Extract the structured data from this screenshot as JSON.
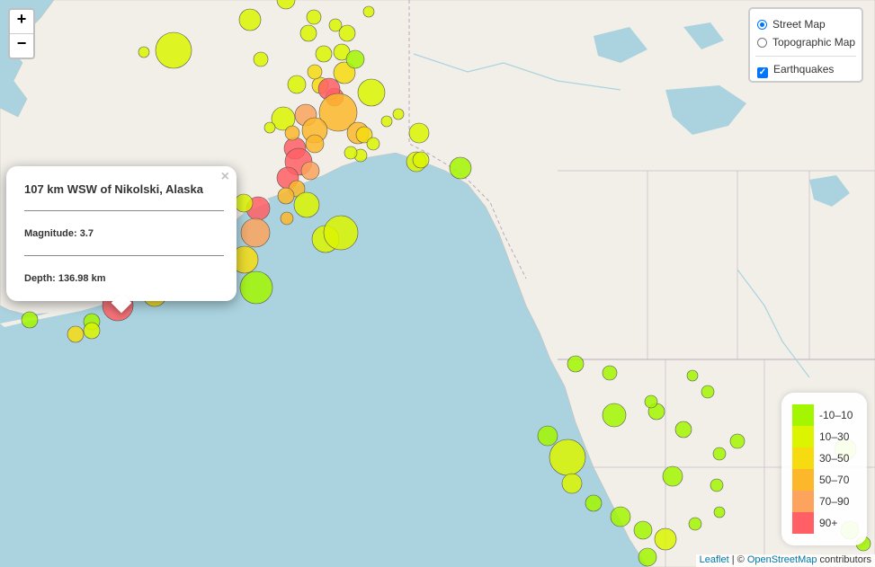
{
  "zoom": {
    "in_label": "+",
    "out_label": "−"
  },
  "layers": {
    "base": [
      {
        "label": "Street Map",
        "selected": true
      },
      {
        "label": "Topographic Map",
        "selected": false
      }
    ],
    "overlays": [
      {
        "label": "Earthquakes",
        "checked": true
      }
    ]
  },
  "popup": {
    "title": "107 km WSW of Nikolski, Alaska",
    "magnitude": "Magnitude: 3.7",
    "depth": "Depth: 136.98 km",
    "close_label": "×"
  },
  "legend": {
    "items": [
      {
        "label": "-10–10",
        "color": "#a3f600"
      },
      {
        "label": "10–30",
        "color": "#dcf400"
      },
      {
        "label": "30–50",
        "color": "#f7db11"
      },
      {
        "label": "50–70",
        "color": "#fdb72a"
      },
      {
        "label": "70–90",
        "color": "#fca35d"
      },
      {
        "label": "90+",
        "color": "#ff5f65"
      }
    ]
  },
  "attribution": {
    "leaflet": "Leaflet",
    "sep": " | © ",
    "osm": "OpenStreetMap",
    "suffix": " contributors"
  },
  "colors": {
    "water": "#aad3df",
    "land": "#f2efe9",
    "border": "#b9a8b9"
  }
}
